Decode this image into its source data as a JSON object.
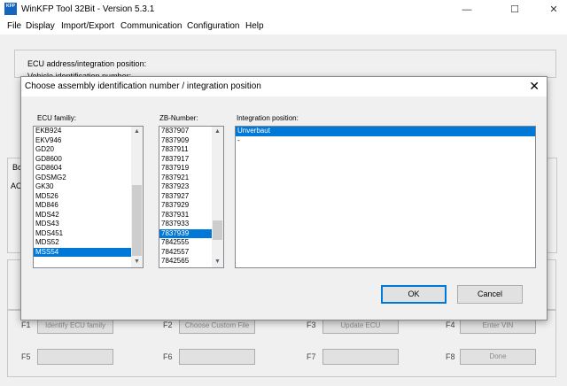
{
  "window": {
    "title": "WinKFP Tool 32Bit - Version 5.3.1",
    "icon_text": "KFP",
    "minimize": "—",
    "maximize": "☐",
    "close": "✕"
  },
  "menu": [
    "File",
    "Display",
    "Import/Export",
    "Communication",
    "Configuration",
    "Help"
  ],
  "background": {
    "ecu_address_label": "ECU address/integration position:",
    "vehicle_id_label": "Vehicle identification number:",
    "bo_label": "Bo",
    "ac_label": "AC"
  },
  "fkeys": [
    {
      "key": "F1",
      "label": "Identify ECU family"
    },
    {
      "key": "F2",
      "label": "Choose Custom File"
    },
    {
      "key": "F3",
      "label": "Update ECU"
    },
    {
      "key": "F4",
      "label": "Enter VIN"
    },
    {
      "key": "F5",
      "label": ""
    },
    {
      "key": "F6",
      "label": ""
    },
    {
      "key": "F7",
      "label": ""
    },
    {
      "key": "F8",
      "label": "Done"
    }
  ],
  "dialog": {
    "title": "Choose assembly identification number / integration position",
    "close": "✕",
    "ecu_family_label": "ECU familiy:",
    "zb_label": "ZB-Number:",
    "integration_label": "Integration position:",
    "ecu_family_items": [
      "EKB924",
      "EKV946",
      "GD20",
      "GD8600",
      "GD8604",
      "GDSMG2",
      "GK30",
      "MD526",
      "MD846",
      "MDS42",
      "MDS43",
      "MDS451",
      "MDS52",
      "MSS54"
    ],
    "ecu_family_selected": 13,
    "zb_items": [
      "7837907",
      "7837909",
      "7837911",
      "7837917",
      "7837919",
      "7837921",
      "7837923",
      "7837927",
      "7837929",
      "7837931",
      "7837933",
      "7837939",
      "7842555",
      "7842557",
      "7842565"
    ],
    "zb_selected": 11,
    "integration_items": [
      "Unverbaut",
      "-"
    ],
    "integration_selected": 0,
    "ok_label": "OK",
    "cancel_label": "Cancel"
  }
}
